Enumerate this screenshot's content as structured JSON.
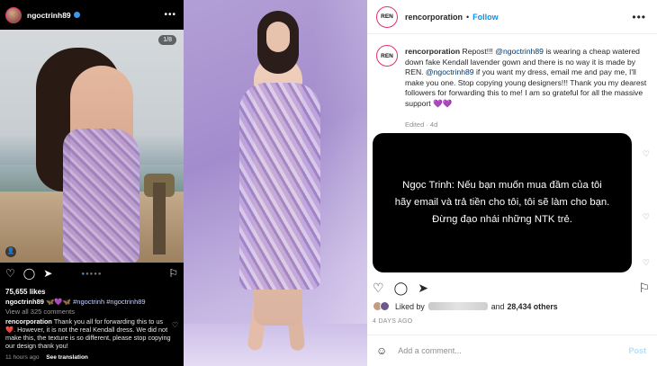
{
  "left_post": {
    "username": "ngoctrinh89",
    "more_icon": "more-horizontal-icon",
    "carousel_counter": "1/8",
    "likes": "75,655 likes",
    "owner_caption_user": "ngoctrinh89",
    "owner_caption_emojis": "🦋💜🦋",
    "owner_caption_tags": "#ngoctrinh #ngoctrinh89",
    "view_comments": "View all 325 comments",
    "comment_user": "rencorporation",
    "comment_text": "Thank you all for forwarding this to us ❤️. However, it is not the real Kendall dress. We did not make this, the texture is so different, please stop copying our design thank you!",
    "timestamp": "11 hours ago",
    "see_translation": "See translation",
    "heart": "♡"
  },
  "right_post": {
    "username": "rencorporation",
    "dot": "•",
    "follow_label": "Follow",
    "logo_text": "REN",
    "caption_user": "rencorporation",
    "caption_part1": " Repost!!! ",
    "mention1": "@ngoctrinh89",
    "caption_part2": " is wearing a cheap watered down fake Kendall lavender gown and there is no way it is made by REN. ",
    "mention2": "@ngoctrinh89",
    "caption_part3": " if you want my dress, email me and pay me, I'll make you one. Stop copying young designers!!! Thank you my dearest followers for forwarding this to me! I am so grateful for all the massive support 💜💜",
    "edited": "Edited · 4d",
    "overlay_line1": "Ngọc Trinh: Nếu bạn muốn mua đầm của tôi",
    "overlay_line2": "hãy email và trả tiền cho tôi, tôi sẽ làm cho bạn.",
    "overlay_line3": "Đừng đạo nhái những NTK trẻ.",
    "liked_by_label": "Liked by",
    "and_label": "and",
    "others_count": "28,434 others",
    "date": "4 DAYS AGO",
    "comment_placeholder": "Add a comment...",
    "post_label": "Post"
  },
  "colors": {
    "accent_blue": "#0095f6",
    "heart_purple": "#a64dff",
    "story_ring": "#e1306c"
  }
}
